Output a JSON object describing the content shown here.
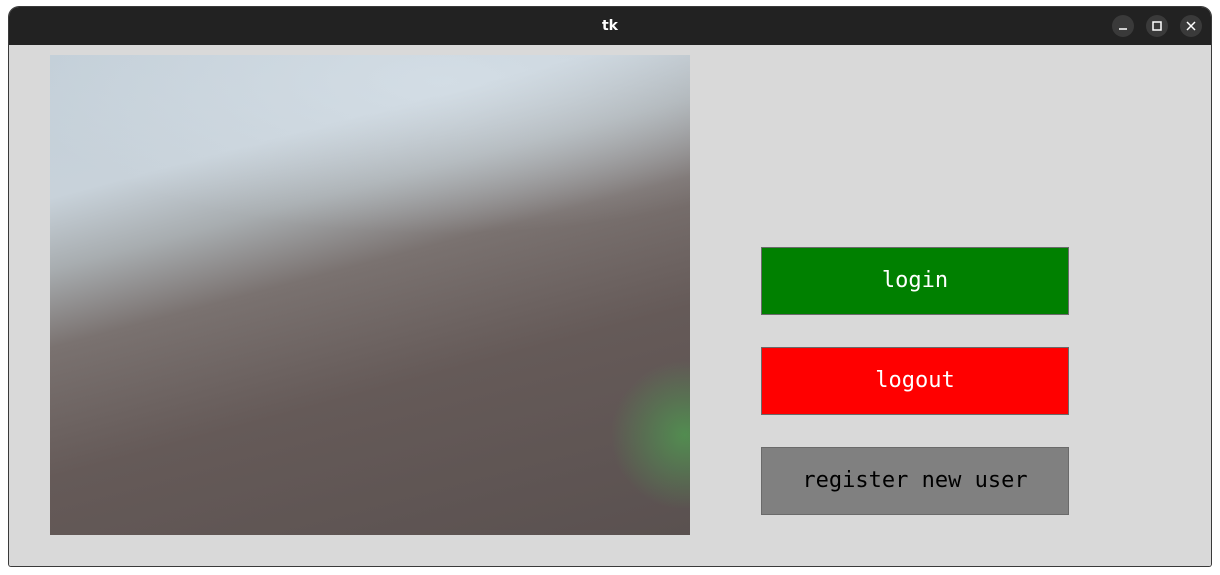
{
  "window": {
    "title": "tk",
    "controls": [
      "minimize-icon",
      "maximize-icon",
      "close-icon"
    ]
  },
  "buttons": {
    "login": {
      "label": "login",
      "bg": "#008000",
      "fg": "#ffffff"
    },
    "logout": {
      "label": "logout",
      "bg": "#ff0000",
      "fg": "#ffffff"
    },
    "register": {
      "label": "register new user",
      "bg": "#808080",
      "fg": "#000000"
    }
  },
  "colors": {
    "titlebar": "#222222",
    "background": "#d9d9d9"
  }
}
